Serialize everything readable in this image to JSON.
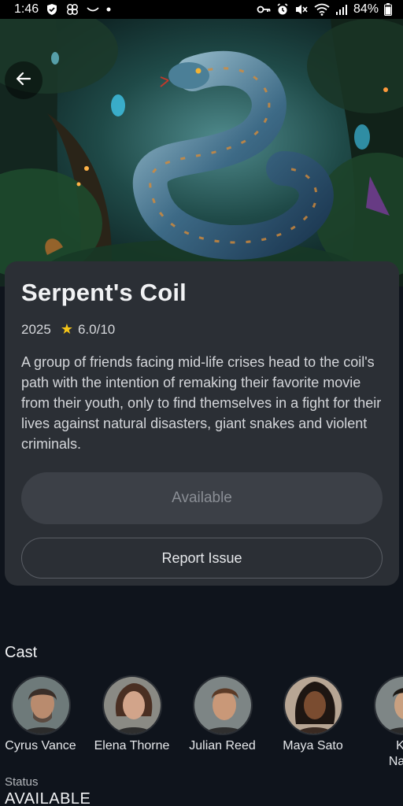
{
  "status_bar": {
    "time": "1:46",
    "battery": "84%",
    "icons_left": [
      "shield-check-icon",
      "cloverleaf-icon",
      "voicemail-icon",
      "dot-icon"
    ],
    "icons_right": [
      "key-icon",
      "alarm-icon",
      "mute-icon",
      "wifi-icon",
      "signal-icon",
      "battery-icon"
    ]
  },
  "hero": {
    "image": "jungle-serpent-poster"
  },
  "movie": {
    "title": "Serpent's Coil",
    "year": "2025",
    "rating": "6.0/10",
    "synopsis": "A group of friends facing mid-life crises head to the coil's path with the intention of remaking their favorite movie from their youth, only to find themselves in a fight for their lives against natural disasters, giant snakes and violent criminals."
  },
  "actions": {
    "available_label": "Available",
    "report_label": "Report Issue"
  },
  "cast": {
    "heading": "Cast",
    "members": [
      {
        "name": "Cyrus Vance"
      },
      {
        "name": "Elena Thorne"
      },
      {
        "name": "Julian Reed"
      },
      {
        "name": "Maya Sato"
      },
      {
        "name": "Ks\nNaka"
      }
    ]
  },
  "status": {
    "label": "Status",
    "value": "AVAILABLE"
  },
  "colors": {
    "background": "#0f141c",
    "card": "#2b2f35",
    "star": "#f5c518"
  }
}
